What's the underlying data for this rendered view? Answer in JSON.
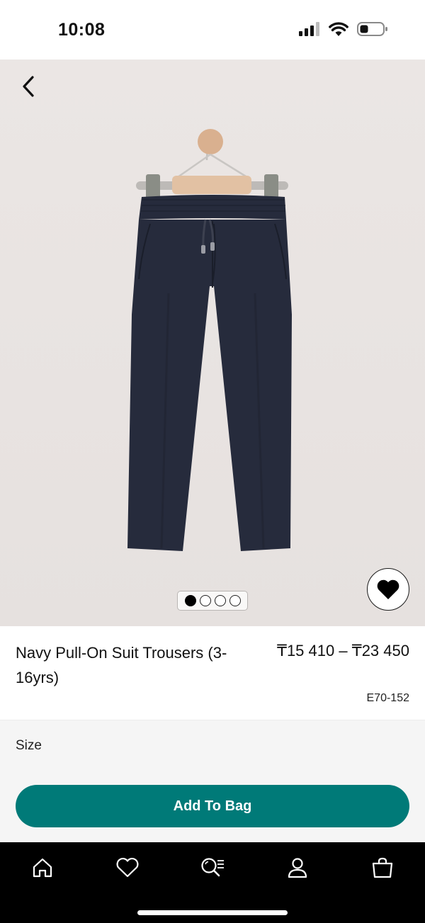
{
  "status_bar": {
    "time": "10:08",
    "icons": [
      "cellular-signal-icon",
      "wifi-icon",
      "battery-icon"
    ]
  },
  "gallery": {
    "image_count": 4,
    "active_index": 0,
    "back_icon": "chevron-left-icon",
    "favorite_icon": "heart-icon"
  },
  "product": {
    "title": "Navy Pull-On Suit Trousers (3-16yrs)",
    "price": "₸15 410 – ₸23 450",
    "code": "E70-152"
  },
  "size": {
    "label": "Size"
  },
  "actions": {
    "add_to_bag": "Add To Bag"
  },
  "tab_bar": {
    "tabs": [
      "home-icon",
      "heart-icon",
      "search-list-icon",
      "account-icon",
      "bag-icon"
    ]
  },
  "colors": {
    "accent": "#007a78",
    "tab_bar_bg": "#000000",
    "product_navy": "#262b3c"
  }
}
